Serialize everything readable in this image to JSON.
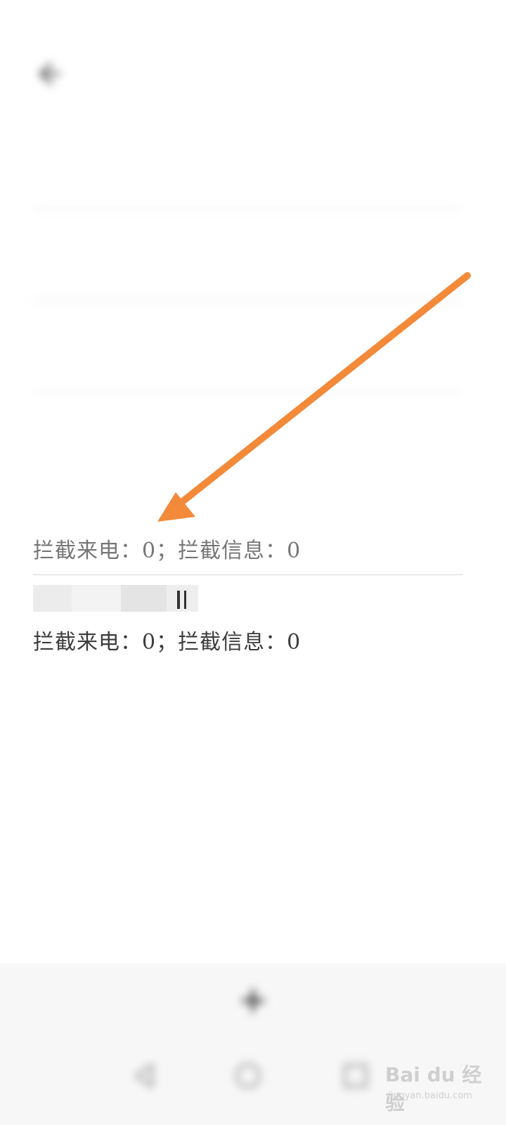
{
  "status_bar": {
    "left_text": "",
    "right_text": ""
  },
  "header": {
    "title": ""
  },
  "blocklist": {
    "items": [
      {
        "number": "",
        "summary": ""
      },
      {
        "number": "",
        "summary": ""
      },
      {
        "number": "",
        "summary": ""
      },
      {
        "number": "",
        "summary": ""
      },
      {
        "number": "",
        "summary": "拦截来电：0；拦截信息：0"
      },
      {
        "number": "",
        "summary": "拦截来电：0；拦截信息：0"
      }
    ]
  },
  "add_button": {
    "label": ""
  },
  "watermark": {
    "brand": "Bai du 经验",
    "url": "jingyan.baidu.com"
  },
  "colors": {
    "arrow": "#f28a3a",
    "background": "#ffffff",
    "divider": "#d7d7d7"
  },
  "icons": {
    "back": "back-arrow-icon",
    "add": "plus-icon",
    "nav_back": "triangle-back-icon",
    "nav_home": "circle-home-icon",
    "nav_recent": "square-recent-icon"
  }
}
